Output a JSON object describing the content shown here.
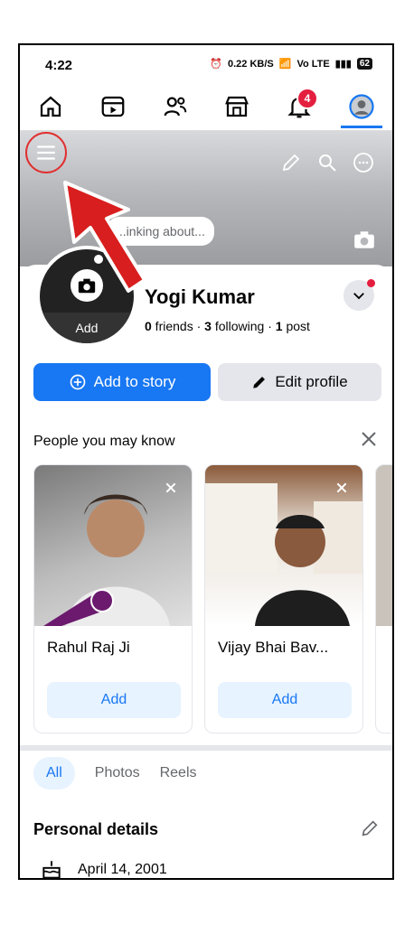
{
  "status_bar": {
    "time": "4:22",
    "net_speed": "0.22 KB/S",
    "volte": "Vo LTE",
    "battery": "62"
  },
  "top_nav": {
    "items": [
      {
        "name": "home",
        "icon": "home-icon"
      },
      {
        "name": "video",
        "icon": "video-icon"
      },
      {
        "name": "friends",
        "icon": "friends-icon"
      },
      {
        "name": "marketplace",
        "icon": "store-icon"
      },
      {
        "name": "notifications",
        "icon": "bell-icon",
        "badge": "4"
      },
      {
        "name": "profile",
        "icon": "avatar-icon",
        "active": true
      }
    ]
  },
  "cover": {
    "thought_placeholder": "...inking about..."
  },
  "profile": {
    "avatar_add": "Add",
    "name": "Yogi Kumar",
    "friends_count": "0",
    "friends_label": " friends · ",
    "following_count": "3",
    "following_label": " following · ",
    "posts_count": "1",
    "posts_label": " post"
  },
  "actions": {
    "add_story": "Add to story",
    "edit_profile": "Edit profile"
  },
  "pymk": {
    "title": "People you may know",
    "cards": [
      {
        "name": "Rahul Raj Ji",
        "add": "Add"
      },
      {
        "name": "Vijay Bhai Bav...",
        "add": "Add"
      }
    ]
  },
  "tabs": [
    {
      "label": "All",
      "active": true
    },
    {
      "label": "Photos"
    },
    {
      "label": "Reels"
    }
  ],
  "personal": {
    "title": "Personal details",
    "birthday": "April 14, 2001"
  },
  "colors": {
    "accent": "#1877f2",
    "badge": "#e41e3f",
    "highlight": "#e03030"
  }
}
